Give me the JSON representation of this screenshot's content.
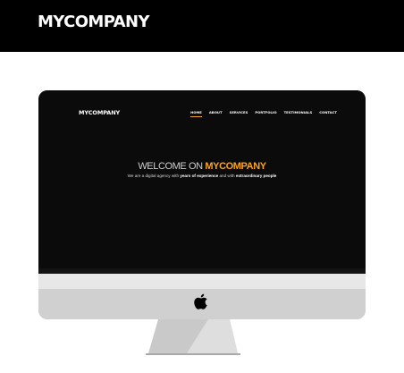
{
  "header": {
    "brand": "MYCOMPANY"
  },
  "site": {
    "logo": "MYCOMPANY",
    "nav": [
      "HOME",
      "ABOUT",
      "SERVICES",
      "PORTFOLIO",
      "TESTIMONIALS",
      "CONTACT"
    ],
    "active_nav": "HOME",
    "hero": {
      "title_light": "WELCOME ON ",
      "title_accent": "MYCOMPANY",
      "sub_1": "We are a digital agency with ",
      "sub_bold_1": "years of experience",
      "sub_2": " and with ",
      "sub_bold_2": "extraordinary people"
    }
  },
  "colors": {
    "accent": "#f7a325",
    "header_bg": "#000000",
    "screen_bg": "#0b0b0b",
    "imac_body": "#d4d4d4"
  },
  "icons": {
    "apple": "apple-logo-icon"
  }
}
